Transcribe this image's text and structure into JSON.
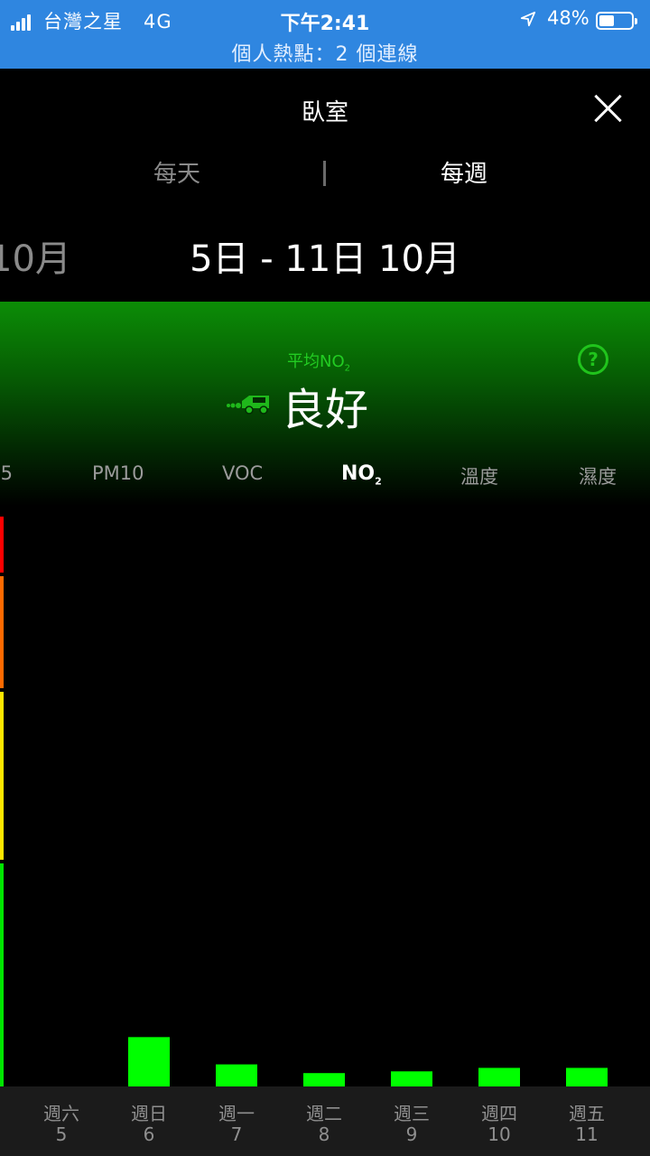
{
  "status_bar": {
    "carrier": "台灣之星",
    "network": "4G",
    "time": "下午2:41",
    "battery_pct": "48%",
    "battery_level": 0.48,
    "hotspot": "個人熱點：2 個連線"
  },
  "header": {
    "title": "臥室",
    "close_icon": "close-icon"
  },
  "period_tabs": {
    "daily": "每天",
    "weekly": "每週",
    "active": "weekly"
  },
  "date_range": {
    "previous": "10月",
    "current": "5日 - 11日 10月"
  },
  "summary": {
    "avg_label_prefix": "平均",
    "avg_label_pollutant": "NO",
    "avg_label_sub": "2",
    "status": "良好",
    "status_color": "#00ff00",
    "help_symbol": "?",
    "icon": "car-exhaust-icon"
  },
  "pollutant_tabs": {
    "pm25_partial": ".5",
    "pm10": "PM10",
    "voc": "VOC",
    "no2": "NO",
    "no2_sub": "2",
    "temperature": "溫度",
    "humidity": "濕度",
    "active": "no2"
  },
  "scale_colors": [
    "#ff0000",
    "#ff6a00",
    "#ffe600",
    "#00e600"
  ],
  "chart_data": {
    "type": "bar",
    "categories": [
      "週六 5",
      "週日 6",
      "週一 7",
      "週二 8",
      "週三 9",
      "週四 10",
      "週五 11"
    ],
    "day_names": [
      "週六",
      "週日",
      "週一",
      "週二",
      "週三",
      "週四",
      "週五"
    ],
    "day_numbers": [
      "5",
      "6",
      "7",
      "8",
      "9",
      "10",
      "11"
    ],
    "values": [
      0,
      8.5,
      3.8,
      2.3,
      2.6,
      3.2,
      3.2
    ],
    "ylim": [
      0,
      100
    ],
    "bar_color": "#00ff00",
    "title": "",
    "xlabel": "",
    "ylabel": ""
  }
}
